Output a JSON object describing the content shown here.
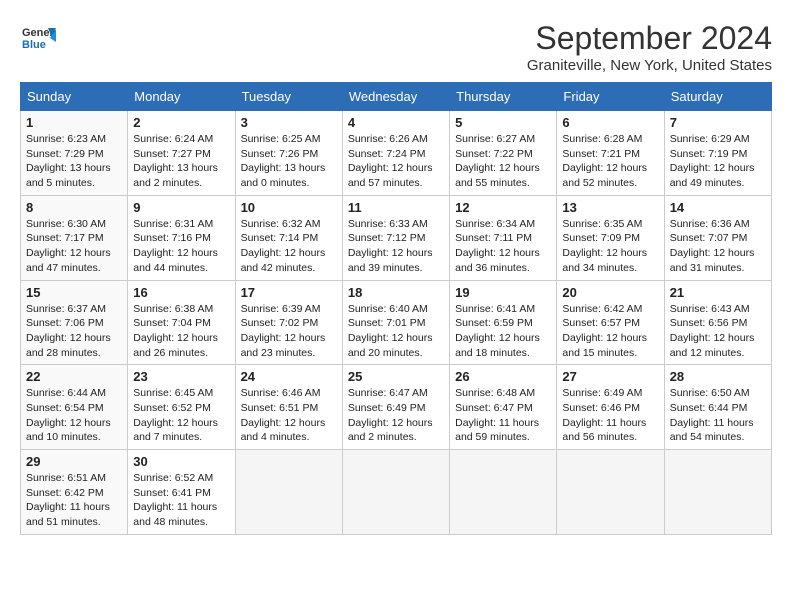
{
  "header": {
    "logo_line1": "General",
    "logo_line2": "Blue",
    "title": "September 2024",
    "subtitle": "Graniteville, New York, United States"
  },
  "weekdays": [
    "Sunday",
    "Monday",
    "Tuesday",
    "Wednesday",
    "Thursday",
    "Friday",
    "Saturday"
  ],
  "weeks": [
    [
      {
        "day": "1",
        "sunrise": "6:23 AM",
        "sunset": "7:29 PM",
        "daylight": "13 hours and 5 minutes."
      },
      {
        "day": "2",
        "sunrise": "6:24 AM",
        "sunset": "7:27 PM",
        "daylight": "13 hours and 2 minutes."
      },
      {
        "day": "3",
        "sunrise": "6:25 AM",
        "sunset": "7:26 PM",
        "daylight": "13 hours and 0 minutes."
      },
      {
        "day": "4",
        "sunrise": "6:26 AM",
        "sunset": "7:24 PM",
        "daylight": "12 hours and 57 minutes."
      },
      {
        "day": "5",
        "sunrise": "6:27 AM",
        "sunset": "7:22 PM",
        "daylight": "12 hours and 55 minutes."
      },
      {
        "day": "6",
        "sunrise": "6:28 AM",
        "sunset": "7:21 PM",
        "daylight": "12 hours and 52 minutes."
      },
      {
        "day": "7",
        "sunrise": "6:29 AM",
        "sunset": "7:19 PM",
        "daylight": "12 hours and 49 minutes."
      }
    ],
    [
      {
        "day": "8",
        "sunrise": "6:30 AM",
        "sunset": "7:17 PM",
        "daylight": "12 hours and 47 minutes."
      },
      {
        "day": "9",
        "sunrise": "6:31 AM",
        "sunset": "7:16 PM",
        "daylight": "12 hours and 44 minutes."
      },
      {
        "day": "10",
        "sunrise": "6:32 AM",
        "sunset": "7:14 PM",
        "daylight": "12 hours and 42 minutes."
      },
      {
        "day": "11",
        "sunrise": "6:33 AM",
        "sunset": "7:12 PM",
        "daylight": "12 hours and 39 minutes."
      },
      {
        "day": "12",
        "sunrise": "6:34 AM",
        "sunset": "7:11 PM",
        "daylight": "12 hours and 36 minutes."
      },
      {
        "day": "13",
        "sunrise": "6:35 AM",
        "sunset": "7:09 PM",
        "daylight": "12 hours and 34 minutes."
      },
      {
        "day": "14",
        "sunrise": "6:36 AM",
        "sunset": "7:07 PM",
        "daylight": "12 hours and 31 minutes."
      }
    ],
    [
      {
        "day": "15",
        "sunrise": "6:37 AM",
        "sunset": "7:06 PM",
        "daylight": "12 hours and 28 minutes."
      },
      {
        "day": "16",
        "sunrise": "6:38 AM",
        "sunset": "7:04 PM",
        "daylight": "12 hours and 26 minutes."
      },
      {
        "day": "17",
        "sunrise": "6:39 AM",
        "sunset": "7:02 PM",
        "daylight": "12 hours and 23 minutes."
      },
      {
        "day": "18",
        "sunrise": "6:40 AM",
        "sunset": "7:01 PM",
        "daylight": "12 hours and 20 minutes."
      },
      {
        "day": "19",
        "sunrise": "6:41 AM",
        "sunset": "6:59 PM",
        "daylight": "12 hours and 18 minutes."
      },
      {
        "day": "20",
        "sunrise": "6:42 AM",
        "sunset": "6:57 PM",
        "daylight": "12 hours and 15 minutes."
      },
      {
        "day": "21",
        "sunrise": "6:43 AM",
        "sunset": "6:56 PM",
        "daylight": "12 hours and 12 minutes."
      }
    ],
    [
      {
        "day": "22",
        "sunrise": "6:44 AM",
        "sunset": "6:54 PM",
        "daylight": "12 hours and 10 minutes."
      },
      {
        "day": "23",
        "sunrise": "6:45 AM",
        "sunset": "6:52 PM",
        "daylight": "12 hours and 7 minutes."
      },
      {
        "day": "24",
        "sunrise": "6:46 AM",
        "sunset": "6:51 PM",
        "daylight": "12 hours and 4 minutes."
      },
      {
        "day": "25",
        "sunrise": "6:47 AM",
        "sunset": "6:49 PM",
        "daylight": "12 hours and 2 minutes."
      },
      {
        "day": "26",
        "sunrise": "6:48 AM",
        "sunset": "6:47 PM",
        "daylight": "11 hours and 59 minutes."
      },
      {
        "day": "27",
        "sunrise": "6:49 AM",
        "sunset": "6:46 PM",
        "daylight": "11 hours and 56 minutes."
      },
      {
        "day": "28",
        "sunrise": "6:50 AM",
        "sunset": "6:44 PM",
        "daylight": "11 hours and 54 minutes."
      }
    ],
    [
      {
        "day": "29",
        "sunrise": "6:51 AM",
        "sunset": "6:42 PM",
        "daylight": "11 hours and 51 minutes."
      },
      {
        "day": "30",
        "sunrise": "6:52 AM",
        "sunset": "6:41 PM",
        "daylight": "11 hours and 48 minutes."
      },
      null,
      null,
      null,
      null,
      null
    ]
  ]
}
